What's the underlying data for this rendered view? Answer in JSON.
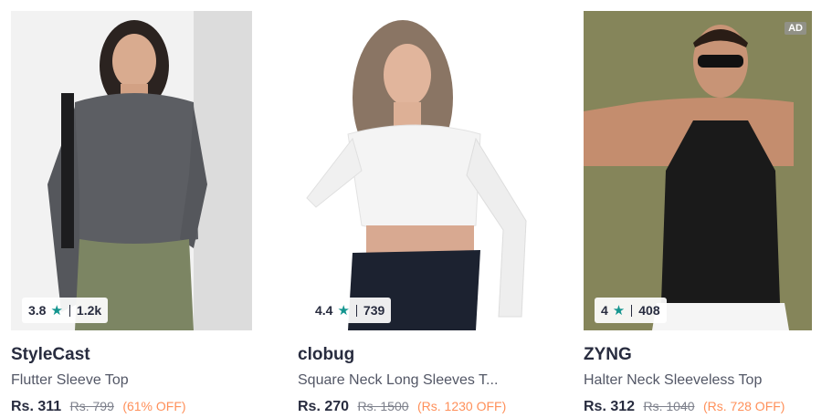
{
  "products": [
    {
      "brand": "StyleCast",
      "title": "Flutter Sleeve Top",
      "price": "Rs. 311",
      "mrp": "Rs. 799",
      "discount": "(61% OFF)",
      "rating": "3.8",
      "rating_count": "1.2k"
    },
    {
      "brand": "clobug",
      "title": "Square Neck Long Sleeves T...",
      "price": "Rs. 270",
      "mrp": "Rs. 1500",
      "discount": "(Rs. 1230 OFF)",
      "rating": "4.4",
      "rating_count": "739"
    },
    {
      "brand": "ZYNG",
      "title": "Halter Neck Sleeveless Top",
      "price": "Rs. 312",
      "mrp": "Rs. 1040",
      "discount": "(Rs. 728 OFF)",
      "rating": "4",
      "rating_count": "408",
      "ad_label": "AD"
    }
  ],
  "icons": {
    "rating_star": "★"
  },
  "colors": {
    "star": "#14958f",
    "discount": "#ff905a",
    "brand_text": "#282c3f"
  }
}
